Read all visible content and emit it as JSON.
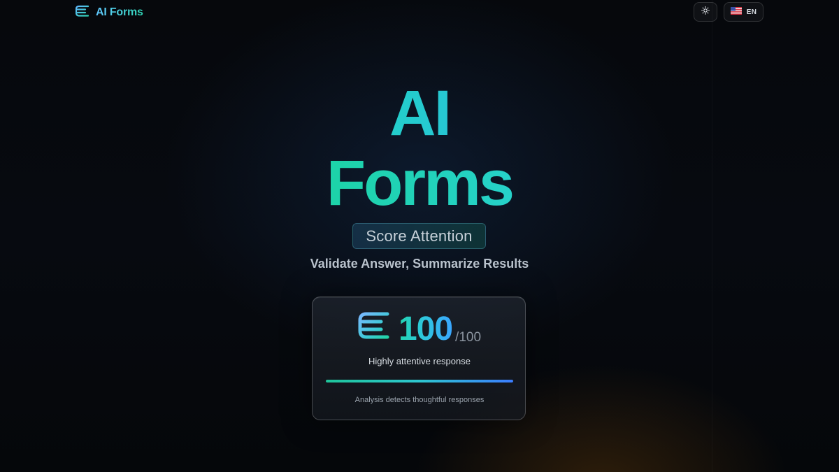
{
  "header": {
    "brand": "AI Forms",
    "logo_icon": "stacked-lines-icon",
    "theme_icon": "sun-icon",
    "language": {
      "flag_icon": "us-flag-icon",
      "label": "EN"
    }
  },
  "hero": {
    "title_line1": "AI",
    "title_line2": "Forms",
    "pill": "Score Attention",
    "subtitle": "Validate Answer, Summarize Results"
  },
  "score_card": {
    "icon": "stacked-lines-icon",
    "score": "100",
    "max": "/100",
    "description": "Highly attentive response",
    "progress": 1.0,
    "note": "Analysis detects thoughtful responses"
  },
  "colors": {
    "background": "#05070b",
    "accent_cyan": "#4bd4ff",
    "accent_teal": "#1dd3a9",
    "accent_blue": "#3b7dff"
  }
}
